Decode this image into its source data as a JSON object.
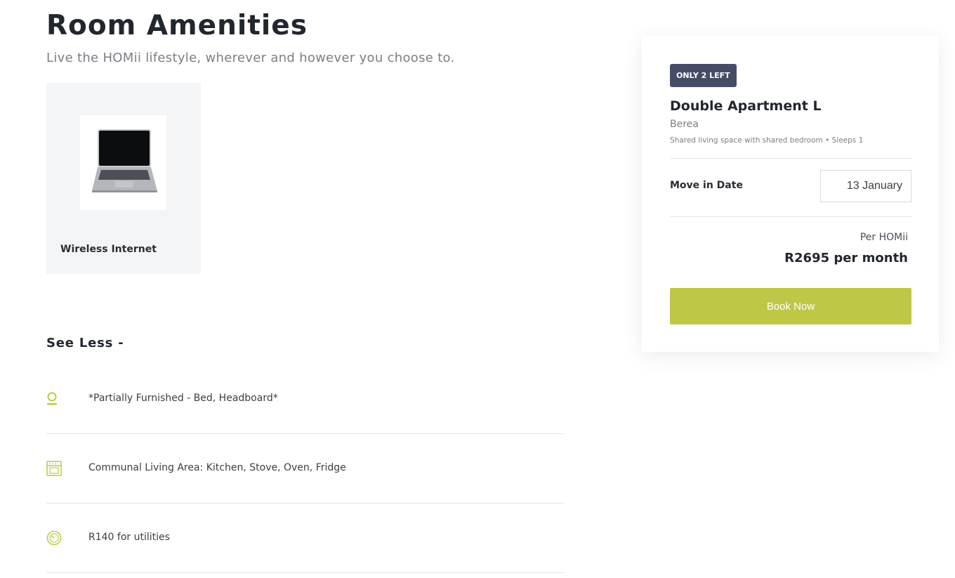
{
  "header": {
    "title": "Room Amenities",
    "subtitle": "Live the HOMii lifestyle, wherever and however you choose to."
  },
  "amenity_cards": [
    {
      "label": "Wireless Internet",
      "icon": "laptop-image"
    }
  ],
  "toggle": {
    "label": "See Less -"
  },
  "features": [
    {
      "text": "*Partially Furnished - Bed, Headboard*",
      "icon": "lamp-icon"
    },
    {
      "text": "Communal Living Area: Kitchen, Stove, Oven, Fridge",
      "icon": "oven-icon"
    },
    {
      "text": "R140 for utilities",
      "icon": "meter-icon"
    }
  ],
  "booking": {
    "badge": "ONLY 2 LEFT",
    "name": "Double Apartment L",
    "location": "Berea",
    "description": "Shared living space with shared bedroom • Sleeps 1",
    "move_in_label": "Move in Date",
    "move_in_value": "13 January",
    "per_label": "Per HOMii",
    "price": "R2695 per month",
    "button_label": "Book Now"
  },
  "colors": {
    "accent": "#bfc846",
    "badge": "#454c66",
    "card_background": "#f4f5f7"
  }
}
